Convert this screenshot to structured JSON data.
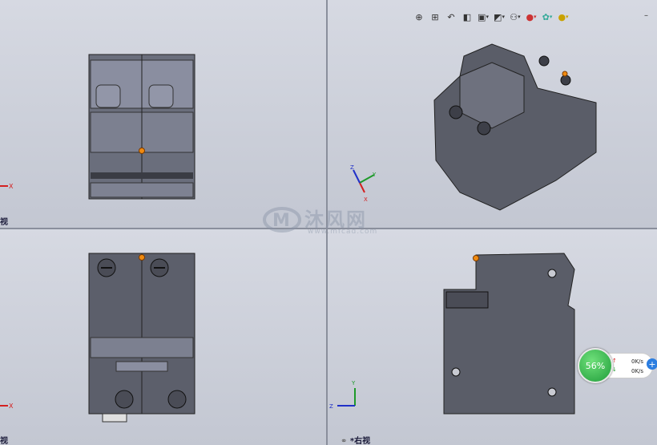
{
  "views": {
    "bottom_right_label": "*右视",
    "top_left_label": "视",
    "bottom_left_label": "视"
  },
  "axes": {
    "x": "X",
    "y": "Y",
    "z": "Z"
  },
  "toolbar": {
    "icons": [
      "zoom-to-fit-icon",
      "zoom-area-icon",
      "previous-view-icon",
      "section-view-icon",
      "view-orientation-icon",
      "display-style-icon",
      "hide-show-icon",
      "edit-appearance-icon",
      "apply-scene-icon",
      "view-settings-icon"
    ]
  },
  "network_widget": {
    "percent": "56%",
    "upload": "0K/s",
    "download": "0K/s"
  },
  "watermark": {
    "brand": "沐风网",
    "url": "www.mfcad.com"
  },
  "colors": {
    "model": "#5a5d68",
    "point": "#f08a10",
    "axis_x": "#d42020",
    "axis_y": "#1e9a2a",
    "axis_z": "#2030c8"
  }
}
